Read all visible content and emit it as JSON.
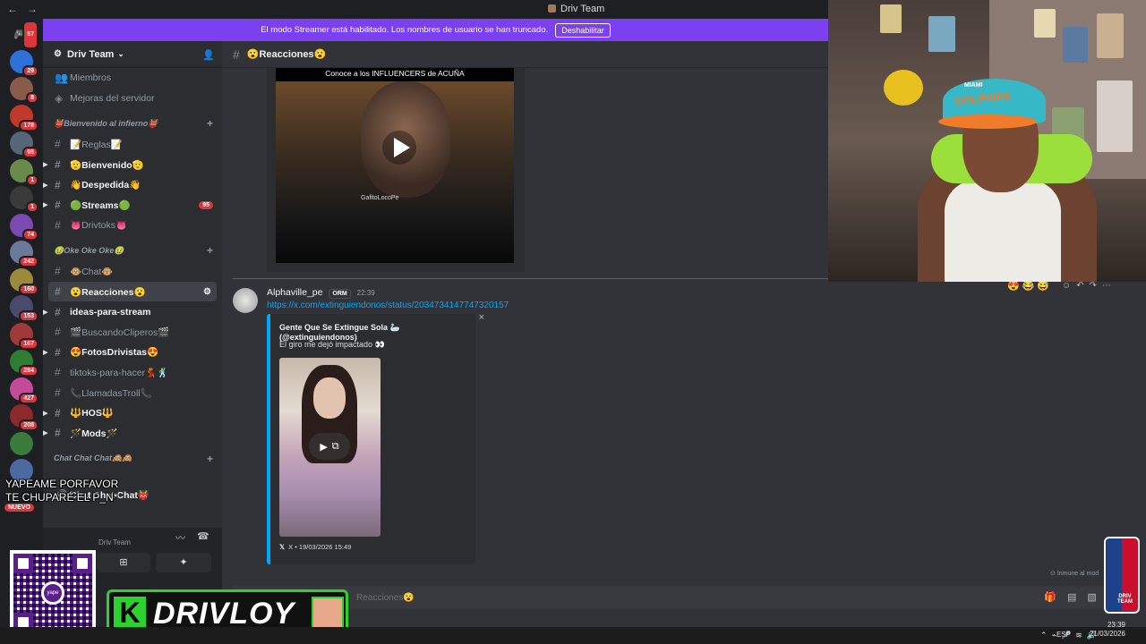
{
  "window": {
    "title": "Driv Team",
    "back": "←",
    "forward": "→"
  },
  "banner": {
    "text": "El modo Streamer está habilitado. Los nombres de usuario se han truncado.",
    "button": "Deshabilitar"
  },
  "server": {
    "name": "Driv Team",
    "caret": "⌄"
  },
  "sidebar": {
    "top_items": [
      {
        "label": "Miembros"
      },
      {
        "label": "Mejoras del servidor"
      }
    ],
    "categories": [
      {
        "label": "👹Bienvenido al infierno👹",
        "channels": [
          {
            "label": "📝Reglas📝",
            "bold": false
          },
          {
            "label": "🫡Bienvenido🫡",
            "bold": true
          },
          {
            "label": "👋Despedida👋",
            "bold": true
          },
          {
            "label": "🟢Streams🟢",
            "bold": true,
            "count": "95"
          },
          {
            "label": "👅Drivtoks👅",
            "bold": false
          }
        ]
      },
      {
        "label": "🤢Oke Oke Oke🤢",
        "channels": [
          {
            "label": "🐵Chat🐵",
            "bold": false
          },
          {
            "label": "😮Reacciones😮",
            "bold": true,
            "active": true
          },
          {
            "label": "ideas-para-stream",
            "bold": true
          },
          {
            "label": "🎬BuscandoCliperos🎬",
            "bold": false
          },
          {
            "label": "😍FotosDrivistas😍",
            "bold": true
          },
          {
            "label": "tiktoks-para-hacer💃🕺",
            "bold": false
          },
          {
            "label": "📞LlamadasTroll📞",
            "bold": false
          },
          {
            "label": "🔱HOS🔱",
            "bold": true
          },
          {
            "label": "🪄Mods🪄",
            "bold": true
          }
        ]
      },
      {
        "label": "Chat Chat Chat🙈🙈",
        "channels": []
      }
    ],
    "voice_channel": "Chat Chat Chat👹",
    "voice_server": "Driv Team"
  },
  "guild_badges": [
    "57",
    "29",
    "8",
    "178",
    "95",
    "1",
    "1",
    "74",
    "242",
    "160",
    "153",
    "107",
    "284",
    "427",
    "208"
  ],
  "chat": {
    "channel": "😮Reacciones😮",
    "video_title": "Conoce a los INFLUENCERS de ACUÑA",
    "video_watermark": "GafitoLocoPe",
    "message": {
      "author": "Alphaville_pe",
      "tag": "ORM",
      "time": "22:39",
      "link": "https://x.com/extinguiendonos/status/2034734147747320157",
      "embed": {
        "author": "Gente Que Se Extingue Sola 🦢 (@extinguiendonos)",
        "description": "El giro me dejó impactado 👀",
        "footer": "X • 19/03/2026 15:49",
        "close": "×"
      }
    },
    "composer_placeholder": "Reacciones😮",
    "immune_text": "Inmune al mod"
  },
  "overlay": {
    "caption_line1": "YAPEAME PORFAVOR",
    "caption_line2": "TE CHUPARÉ  EL P_N*",
    "brand": "DRIVLOY",
    "brand_letter": "K",
    "nuevo": "NUEVO",
    "qr_label": "yape",
    "cap_text": "DOLPHINS",
    "cap_top": "MIAMI",
    "nba_label": "DRIV TEAM"
  },
  "taskbar": {
    "lang": "ESP",
    "time": "23:39",
    "date": "21/03/2026"
  },
  "colors": {
    "accent": "#7b40f0",
    "link": "#00a8fc",
    "green": "#2ed12e",
    "badge": "#da373c"
  }
}
